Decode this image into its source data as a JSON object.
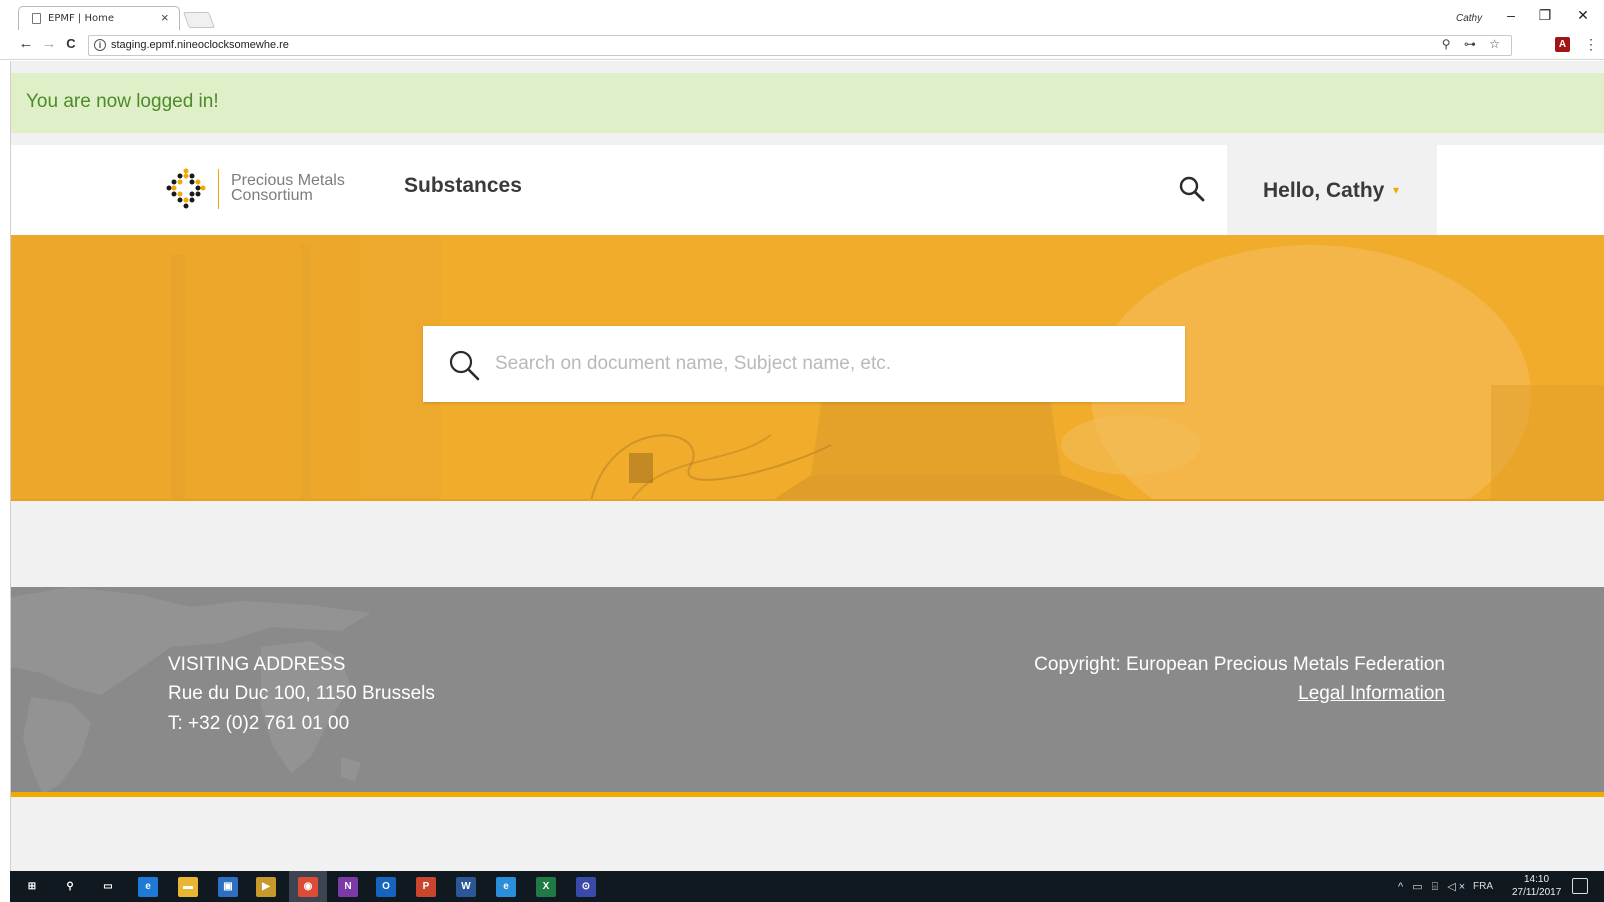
{
  "browser": {
    "tab_title": "EPMF | Home",
    "tab_close": "×",
    "window_user": "Cathy",
    "window_controls": {
      "minimize": "–",
      "restore": "❐",
      "close": "✕"
    },
    "nav": {
      "back": "←",
      "forward": "→",
      "reload": "C"
    },
    "url": "staging.epmf.nineoclocksomewhe.re",
    "omnibox_icons": "⚲ ⊶ ☆",
    "menu": "⋮"
  },
  "flash": {
    "message": "You are now logged in!"
  },
  "header": {
    "logo_line1": "Precious Metals",
    "logo_line2": "Consortium",
    "nav_substances": "Substances",
    "user_greeting": "Hello, Cathy",
    "user_caret": "▾"
  },
  "hero": {
    "search_placeholder": "Search on document name, Subject name, etc."
  },
  "footer": {
    "visiting_label": "VISITING ADDRESS",
    "address": "Rue du Duc 100, 1150 Brussels",
    "phone": "T: +32 (0)2 761 01 00",
    "copyright": "Copyright: European Precious Metals Federation",
    "legal_link": "Legal Information"
  },
  "taskbar": {
    "icons": [
      {
        "name": "start-icon",
        "label": "⊞",
        "color": "#101820"
      },
      {
        "name": "search-icon",
        "label": "⚲",
        "color": "#101820"
      },
      {
        "name": "task-view-icon",
        "label": "▭",
        "color": "#101820"
      },
      {
        "name": "edge-icon",
        "label": "e",
        "color": "#1e7ad6"
      },
      {
        "name": "file-explorer-icon",
        "label": "▬",
        "color": "#e8b632"
      },
      {
        "name": "store-icon",
        "label": "▣",
        "color": "#2d6fc2"
      },
      {
        "name": "app-icon",
        "label": "▶",
        "color": "#c79a2b"
      },
      {
        "name": "chrome-icon",
        "label": "◉",
        "color": "#dd4b39"
      },
      {
        "name": "onenote-icon",
        "label": "N",
        "color": "#7b3aa6"
      },
      {
        "name": "outlook-icon",
        "label": "O",
        "color": "#1565c0"
      },
      {
        "name": "powerpoint-icon",
        "label": "P",
        "color": "#c9452b"
      },
      {
        "name": "word-icon",
        "label": "W",
        "color": "#2b5797"
      },
      {
        "name": "internet-explorer-icon",
        "label": "e",
        "color": "#2a8fd8"
      },
      {
        "name": "excel-icon",
        "label": "X",
        "color": "#1f7a45"
      },
      {
        "name": "keepass-icon",
        "label": "⊙",
        "color": "#3a4aa8"
      }
    ],
    "tray": "^ ▭ ⌹ ◁×",
    "lang": "FRA",
    "time": "14:10",
    "date": "27/11/2017"
  },
  "colors": {
    "accent": "#f2a900",
    "hero": "#f1ac2b",
    "flash_bg": "#dff0c8",
    "flash_text": "#4e8a2a",
    "footer": "#8a8a8a"
  }
}
